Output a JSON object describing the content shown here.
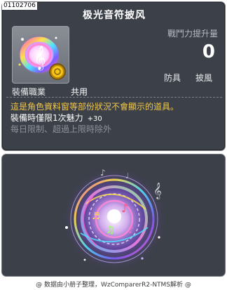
{
  "tooltip": {
    "item_id": "01102706",
    "item_name": "极光音符披风",
    "stat_label": "戰鬥力提升量",
    "stat_value": "0",
    "tags": [
      "防具",
      "披風"
    ],
    "job_label": "裝備職業",
    "job_value": "共用",
    "description_line": "這是角色資料窗等部份狀況不會顯示的道具。",
    "equip_limit": "裝備時僅限1次魅力",
    "equip_bonus": "+30",
    "daily_limit": "每日限制、超過上限時除外"
  },
  "colors": {
    "panel_bg": "#3c4048",
    "highlight_text": "#f2c84a",
    "muted_text": "#8e929a"
  },
  "footer": {
    "credit": "@ 数据由小册子整理，WzComparerR2-NTMS解析 @"
  }
}
